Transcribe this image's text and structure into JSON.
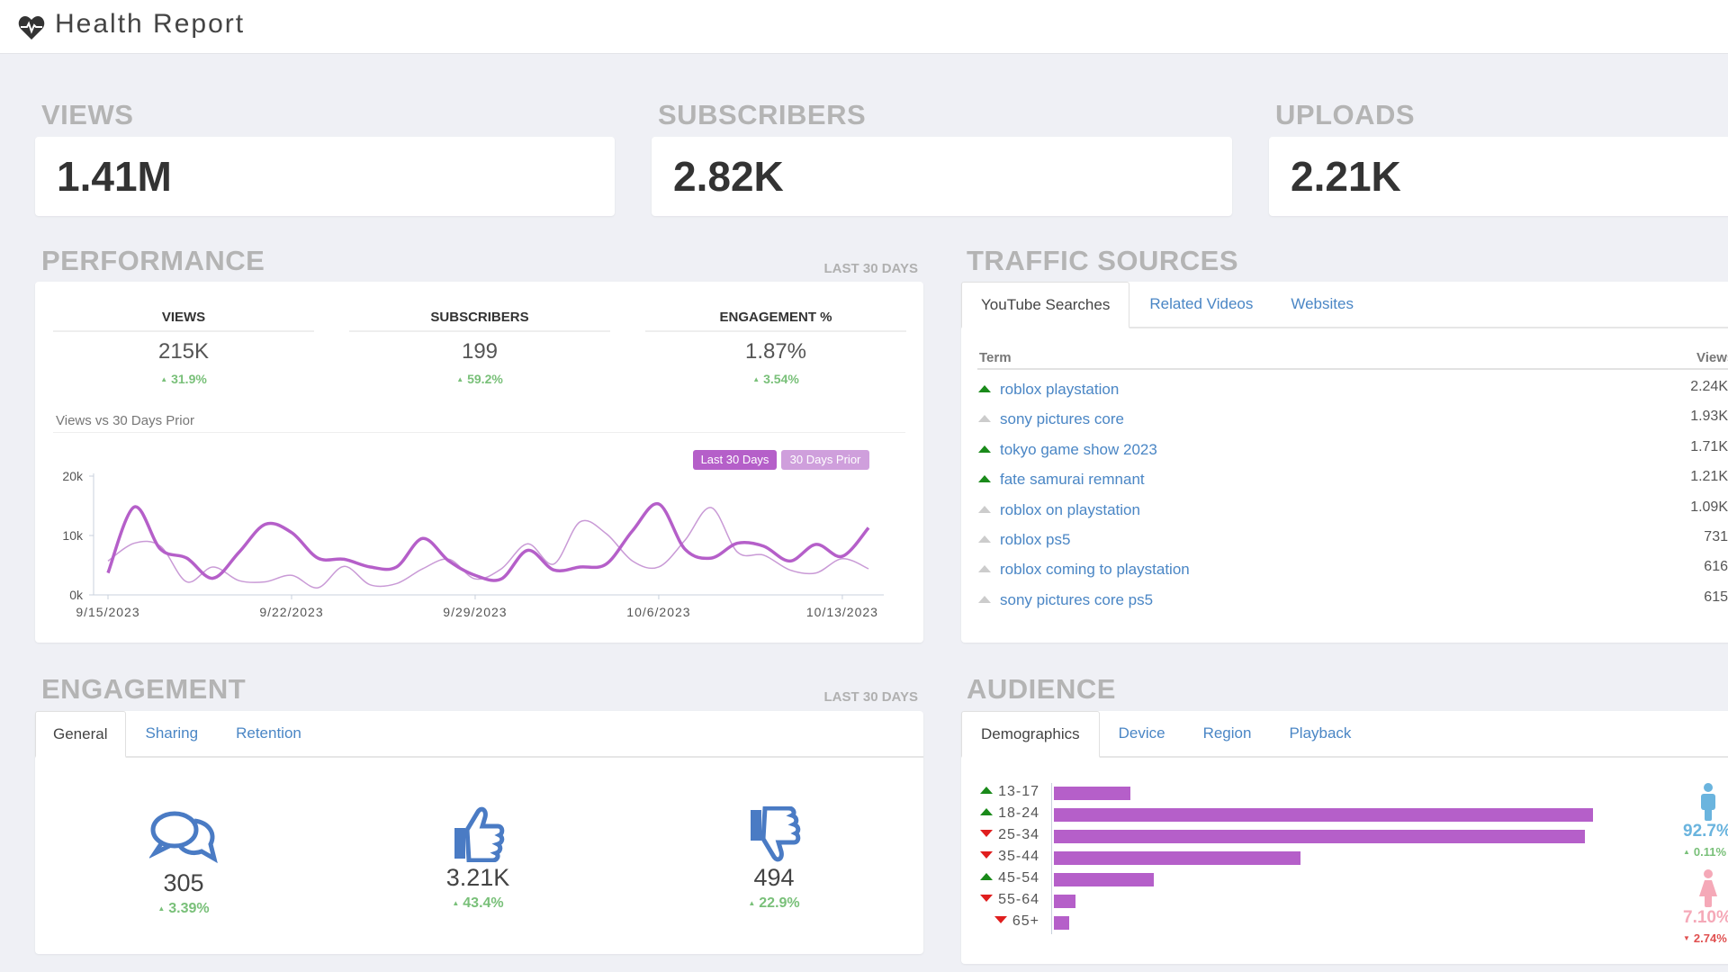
{
  "header": {
    "title": "Health Report",
    "icon": "heartbeat-icon"
  },
  "totals": [
    {
      "label": "VIEWS",
      "value": "1.41M"
    },
    {
      "label": "SUBSCRIBERS",
      "value": "2.82K"
    },
    {
      "label": "UPLOADS",
      "value": "2.21K"
    }
  ],
  "performance": {
    "title": "PERFORMANCE",
    "period": "LAST 30 DAYS",
    "kpis": [
      {
        "label": "VIEWS",
        "value": "215K",
        "change": "31.9%"
      },
      {
        "label": "SUBSCRIBERS",
        "value": "199",
        "change": "59.2%"
      },
      {
        "label": "ENGAGEMENT %",
        "value": "1.87%",
        "change": "3.54%"
      }
    ],
    "chart_title": "Views vs 30 Days Prior"
  },
  "chart_data": {
    "type": "line",
    "title": "Views vs 30 Days Prior",
    "x_start": "9/15/2023",
    "x_ticks": [
      "9/15/2023",
      "9/22/2023",
      "9/29/2023",
      "10/6/2023",
      "10/13/2023"
    ],
    "y_ticks": [
      "0k",
      "10k",
      "20k"
    ],
    "ylim": [
      0,
      20000
    ],
    "legend_position": "top-right",
    "series": [
      {
        "name": "Last 30 Days",
        "color": "#b55fc9",
        "values": [
          3700,
          14800,
          7700,
          6200,
          2800,
          7200,
          11900,
          10500,
          6200,
          6000,
          4700,
          4700,
          9500,
          5700,
          3300,
          2700,
          7500,
          4200,
          4700,
          5200,
          10800,
          15300,
          7700,
          6200,
          8700,
          8200,
          5700,
          8500,
          6500,
          11300
        ]
      },
      {
        "name": "30 Days Prior",
        "color": "#c99ad6",
        "values": [
          5700,
          8700,
          8200,
          2200,
          4700,
          2400,
          2200,
          3300,
          1200,
          4800,
          1700,
          1900,
          4400,
          6000,
          2700,
          4400,
          8600,
          5200,
          12300,
          10300,
          5700,
          4700,
          9200,
          14700,
          7200,
          6700,
          4200,
          3700,
          6100,
          4400
        ]
      }
    ]
  },
  "traffic": {
    "title": "TRAFFIC SOURCES",
    "tabs": [
      "YouTube Searches",
      "Related Videos",
      "Websites"
    ],
    "active_tab": "YouTube Searches",
    "columns": [
      "Term",
      "Views"
    ],
    "rows": [
      {
        "term": "roblox playstation",
        "views": "2.24K",
        "trend": "up"
      },
      {
        "term": "sony pictures core",
        "views": "1.93K",
        "trend": "neutral"
      },
      {
        "term": "tokyo game show 2023",
        "views": "1.71K",
        "trend": "up"
      },
      {
        "term": "fate samurai remnant",
        "views": "1.21K",
        "trend": "up"
      },
      {
        "term": "roblox on playstation",
        "views": "1.09K",
        "trend": "neutral"
      },
      {
        "term": "roblox ps5",
        "views": "731",
        "trend": "neutral"
      },
      {
        "term": "roblox coming to playstation",
        "views": "616",
        "trend": "neutral"
      },
      {
        "term": "sony pictures core ps5",
        "views": "615",
        "trend": "neutral"
      }
    ]
  },
  "engagement": {
    "title": "ENGAGEMENT",
    "period": "LAST 30 DAYS",
    "tabs": [
      "General",
      "Sharing",
      "Retention"
    ],
    "active_tab": "General",
    "items": [
      {
        "icon": "comments-icon",
        "value": "305",
        "change": "3.39%"
      },
      {
        "icon": "thumbs-up-icon",
        "value": "3.21K",
        "change": "43.4%"
      },
      {
        "icon": "thumbs-down-icon",
        "value": "494",
        "change": "22.9%"
      }
    ]
  },
  "audience": {
    "title": "AUDIENCE",
    "tabs": [
      "Demographics",
      "Device",
      "Region",
      "Playback"
    ],
    "active_tab": "Demographics",
    "age_groups": [
      {
        "label": "13-17",
        "percent": 5.0,
        "trend": "up"
      },
      {
        "label": "18-24",
        "percent": 35.2,
        "trend": "up"
      },
      {
        "label": "25-34",
        "percent": 34.7,
        "trend": "down"
      },
      {
        "label": "35-44",
        "percent": 16.1,
        "trend": "down"
      },
      {
        "label": "45-54",
        "percent": 6.5,
        "trend": "up"
      },
      {
        "label": "55-64",
        "percent": 1.4,
        "trend": "down"
      },
      {
        "label": "65+",
        "percent": 1.0,
        "trend": "down"
      }
    ],
    "male": {
      "value": "92.7%",
      "change": "0.11%",
      "trend": "up",
      "color": "#6ab4de"
    },
    "female": {
      "value": "7.10%",
      "change": "2.74%",
      "trend": "down",
      "color": "#f5a9b8"
    }
  }
}
